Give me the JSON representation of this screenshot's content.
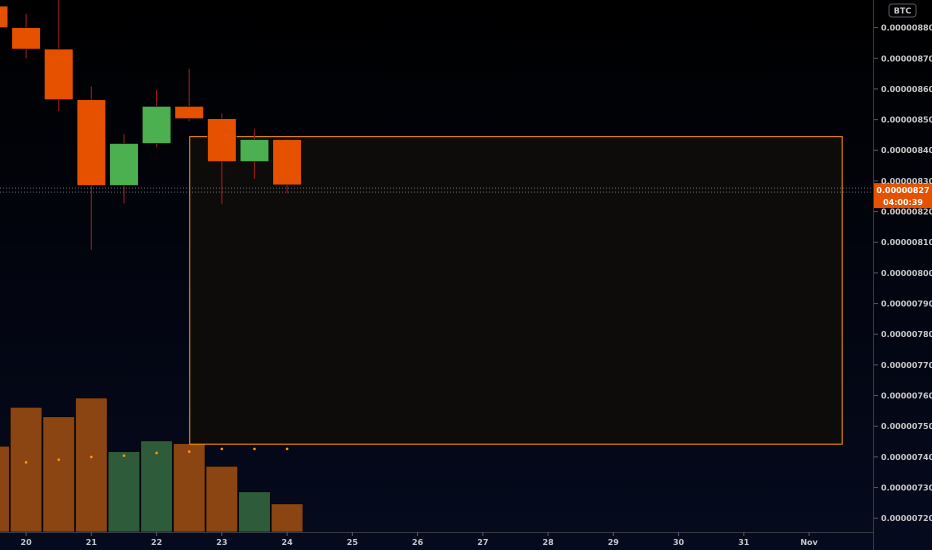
{
  "chart_data": {
    "type": "candlestick",
    "currency_badge": "BTC",
    "y_ticks": [
      "0.00000880",
      "0.00000870",
      "0.00000860",
      "0.00000850",
      "0.00000840",
      "0.00000830",
      "0.00000820",
      "0.00000810",
      "0.00000800",
      "0.00000790",
      "0.00000780",
      "0.00000770",
      "0.00000760",
      "0.00000750",
      "0.00000740",
      "0.00000730",
      "0.00000720"
    ],
    "x_ticks": [
      {
        "label": "20",
        "x": 20
      },
      {
        "label": "21",
        "x": 21
      },
      {
        "label": "22",
        "x": 22
      },
      {
        "label": "23",
        "x": 23
      },
      {
        "label": "24",
        "x": 24
      },
      {
        "label": "25",
        "x": 25
      },
      {
        "label": "26",
        "x": 26
      },
      {
        "label": "27",
        "x": 27
      },
      {
        "label": "28",
        "x": 28
      },
      {
        "label": "29",
        "x": 29
      },
      {
        "label": "30",
        "x": 30
      },
      {
        "label": "31",
        "x": 31
      },
      {
        "label": "Nov",
        "x": 32
      }
    ],
    "ylim": [
      7.155e-06,
      8.89e-06
    ],
    "xlim": [
      19.6,
      32.98
    ],
    "candles": [
      {
        "x": 19.5,
        "open": 8.87e-06,
        "high": 8.89e-06,
        "low": 8.79e-06,
        "close": 8.8e-06
      },
      {
        "x": 20.0,
        "open": 8.8e-06,
        "high": 8.845e-06,
        "low": 8.7e-06,
        "close": 8.73e-06
      },
      {
        "x": 20.5,
        "open": 8.73e-06,
        "high": 8.89e-06,
        "low": 8.528e-06,
        "close": 8.565e-06
      },
      {
        "x": 21.0,
        "open": 8.565e-06,
        "high": 8.608e-06,
        "low": 8.075e-06,
        "close": 8.285e-06
      },
      {
        "x": 21.5,
        "open": 8.285e-06,
        "high": 8.452e-06,
        "low": 8.227e-06,
        "close": 8.422e-06
      },
      {
        "x": 22.0,
        "open": 8.422e-06,
        "high": 8.598e-06,
        "low": 8.41e-06,
        "close": 8.543e-06
      },
      {
        "x": 22.5,
        "open": 8.543e-06,
        "high": 8.665e-06,
        "low": 8.495e-06,
        "close": 8.503e-06
      },
      {
        "x": 23.0,
        "open": 8.503e-06,
        "high": 8.52e-06,
        "low": 8.225e-06,
        "close": 8.363e-06
      },
      {
        "x": 23.5,
        "open": 8.363e-06,
        "high": 8.47e-06,
        "low": 8.307e-06,
        "close": 8.435e-06
      },
      {
        "x": 24.0,
        "open": 8.435e-06,
        "high": 8.437e-06,
        "low": 8.26e-06,
        "close": 8.287e-06
      }
    ],
    "volume": {
      "max": 100,
      "bars": [
        {
          "x": 19.5,
          "value": 64,
          "dir": "down"
        },
        {
          "x": 20.0,
          "value": 93,
          "dir": "down"
        },
        {
          "x": 20.5,
          "value": 86,
          "dir": "down"
        },
        {
          "x": 21.0,
          "value": 100,
          "dir": "down"
        },
        {
          "x": 21.5,
          "value": 60,
          "dir": "up"
        },
        {
          "x": 22.0,
          "value": 68,
          "dir": "up"
        },
        {
          "x": 22.5,
          "value": 66,
          "dir": "down"
        },
        {
          "x": 23.0,
          "value": 49,
          "dir": "down"
        },
        {
          "x": 23.5,
          "value": 30,
          "dir": "up"
        },
        {
          "x": 24.0,
          "value": 21,
          "dir": "down"
        }
      ],
      "ma": [
        {
          "x": 20.0,
          "value": 52
        },
        {
          "x": 20.5,
          "value": 54
        },
        {
          "x": 21.0,
          "value": 56
        },
        {
          "x": 21.5,
          "value": 57
        },
        {
          "x": 22.0,
          "value": 59
        },
        {
          "x": 22.5,
          "value": 60
        },
        {
          "x": 23.0,
          "value": 62
        },
        {
          "x": 23.5,
          "value": 62
        },
        {
          "x": 24.0,
          "value": 62
        }
      ]
    },
    "rectangle": {
      "x0": 22.5,
      "x1": 32.5,
      "y_top": 8.446e-06,
      "y_bottom": 7.443e-06
    },
    "last_price": {
      "value": 8.27e-06,
      "label": "0.00000827",
      "countdown": "04:00:39"
    },
    "colors": {
      "up": "#4caf50",
      "down": "#e65100",
      "wick": "#8b1a1a",
      "vol_up": "#2e5c3a",
      "vol_down": "#8b4513",
      "ma_dot": "#ff9800",
      "rect_border": "#ff9800",
      "rect_fill": "#0f0d0b",
      "price_label_bg": "#e65100",
      "background_top": "#000000",
      "background_bottom": "#050a1e"
    }
  }
}
